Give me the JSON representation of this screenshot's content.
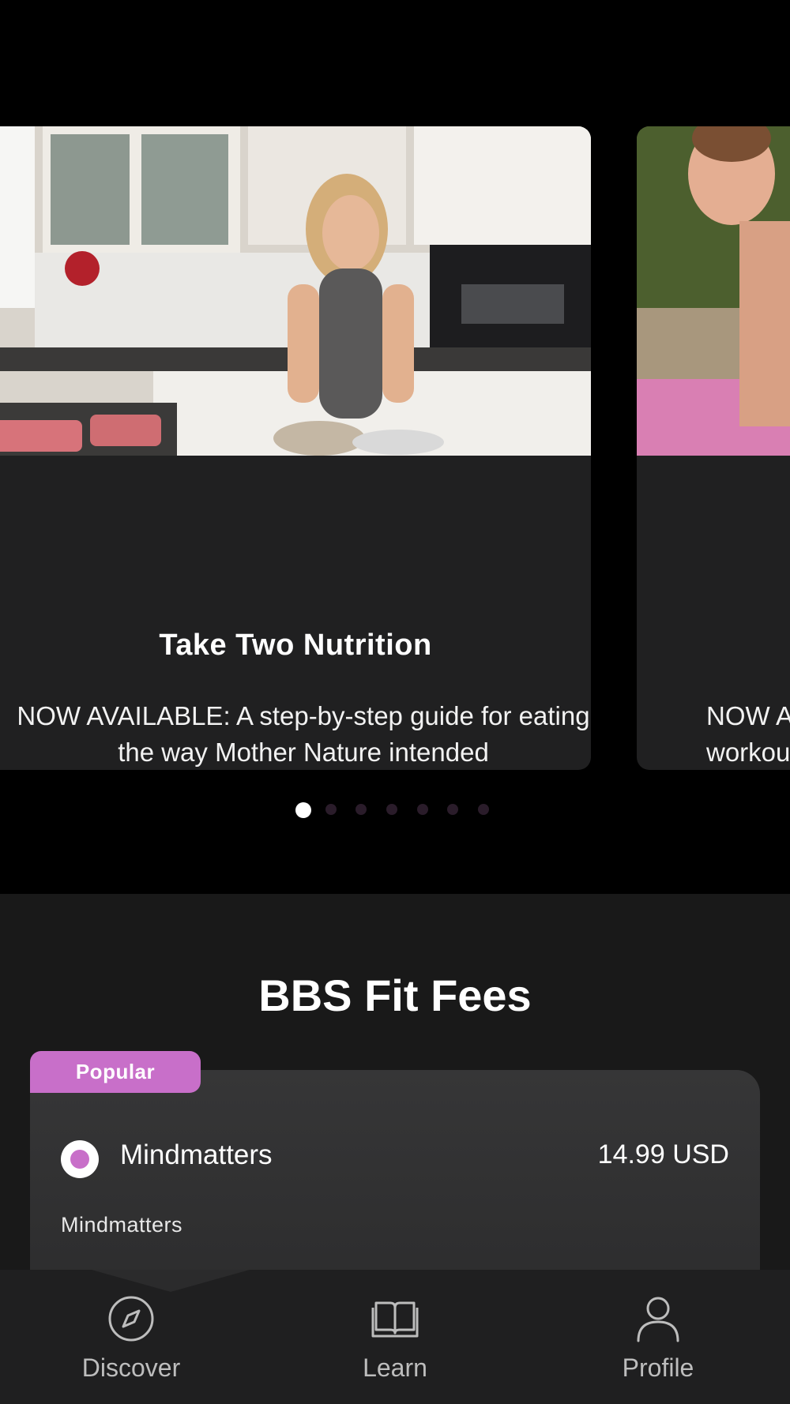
{
  "carousel": {
    "cards": [
      {
        "title": "Take Two Nutrition",
        "description": "NOW AVAILABLE: A step-by-step guide for eating the way Mother Nature intended"
      },
      {
        "title": "",
        "description_lines": [
          "NOW AV",
          "workou"
        ]
      }
    ],
    "page_count": 7,
    "active_page": 1
  },
  "fees": {
    "title": "BBS Fit Fees",
    "plans": [
      {
        "badge": "Popular",
        "name": "Mindmatters",
        "price": "14.99 USD",
        "subtitle": "Mindmatters",
        "selected": true
      }
    ]
  },
  "tabbar": {
    "tabs": [
      {
        "label": "Discover",
        "icon": "compass-icon"
      },
      {
        "label": "Learn",
        "icon": "book-icon"
      },
      {
        "label": "Profile",
        "icon": "person-icon"
      }
    ],
    "active": "Discover"
  },
  "colors": {
    "accent": "#c86fc9",
    "background": "#000000",
    "card": "#202021"
  }
}
